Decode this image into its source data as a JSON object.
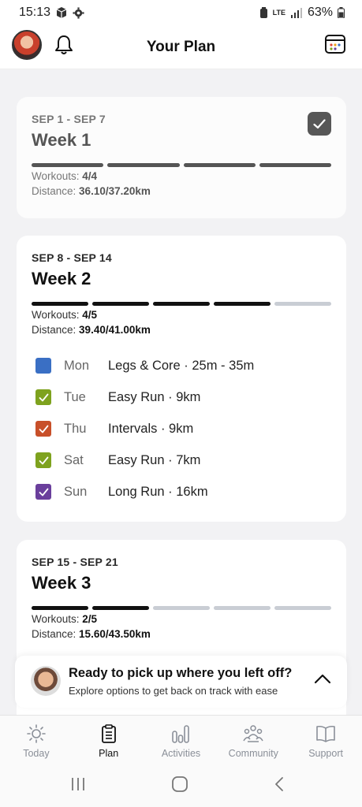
{
  "status_bar": {
    "time": "15:13",
    "network": "LTE",
    "battery": "63%"
  },
  "header": {
    "title": "Your Plan",
    "icons": [
      "avatar",
      "bell-icon",
      "calendar-icon"
    ]
  },
  "weeks": [
    {
      "range": "SEP 1 - SEP 7",
      "title": "Week 1",
      "completed": true,
      "progress_done": 4,
      "progress_total": 4,
      "workouts_label": "Workouts:",
      "workouts_value": "4/4",
      "distance_label": "Distance:",
      "distance_value": "36.10/37.20km"
    },
    {
      "range": "SEP 8 - SEP 14",
      "title": "Week 2",
      "completed": false,
      "progress_done": 4,
      "progress_total": 5,
      "workouts_label": "Workouts:",
      "workouts_value": "4/5",
      "distance_label": "Distance:",
      "distance_value": "39.40/41.00km",
      "workouts": [
        {
          "day": "Mon",
          "name": "Legs & Core · 25m - 35m",
          "color": "#3a6fc4",
          "checked": false
        },
        {
          "day": "Tue",
          "name": "Easy Run · 9km",
          "color": "#7ea21e",
          "checked": true
        },
        {
          "day": "Thu",
          "name": "Intervals · 9km",
          "color": "#c8502a",
          "checked": true
        },
        {
          "day": "Sat",
          "name": "Easy Run · 7km",
          "color": "#7ea21e",
          "checked": true
        },
        {
          "day": "Sun",
          "name": "Long Run · 16km",
          "color": "#6a3f9c",
          "checked": true
        }
      ]
    },
    {
      "range": "SEP 15 - SEP 21",
      "title": "Week 3",
      "completed": false,
      "progress_done": 2,
      "progress_total": 5,
      "workouts_label": "Workouts:",
      "workouts_value": "2/5",
      "distance_label": "Distance:",
      "distance_value": "15.60/43.50km"
    }
  ],
  "resume_banner": {
    "title": "Ready to pick up where you left off?",
    "subtitle": "Explore options to get back on track with ease"
  },
  "bottom_nav": [
    {
      "label": "Today",
      "icon": "sun-icon",
      "active": false
    },
    {
      "label": "Plan",
      "icon": "clipboard-icon",
      "active": true
    },
    {
      "label": "Activities",
      "icon": "bars-icon",
      "active": false
    },
    {
      "label": "Community",
      "icon": "people-icon",
      "active": false
    },
    {
      "label": "Support",
      "icon": "book-icon",
      "active": false
    }
  ],
  "colors": {
    "accent": "#111111",
    "progress_empty": "#c9cdd4",
    "background": "#f2f2f4"
  }
}
